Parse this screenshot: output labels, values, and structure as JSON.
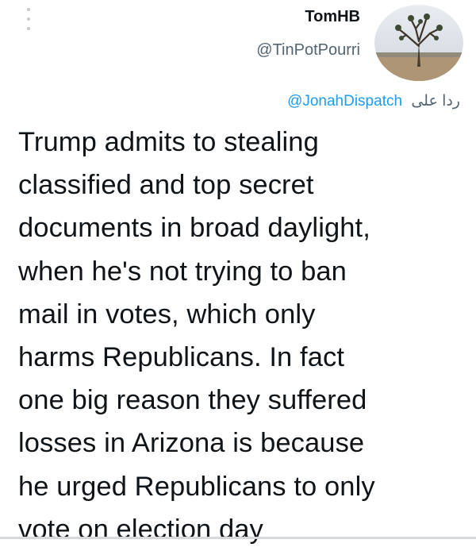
{
  "author": {
    "name": "TomHB",
    "handle": "@TinPotPourri",
    "avatar_icon": "joshua-tree-avatar"
  },
  "reply": {
    "label": "ردا على",
    "target": "@JonahDispatch"
  },
  "tweet": {
    "text": "Trump admits to stealing\nclassified and top secret\ndocuments in broad daylight,\nwhen he's not trying to ban\nmail in votes, which only\nharms Republicans. In fact\none big reason they suffered\nlosses in Arizona is because\nhe urged Republicans to only\nvote on election day"
  },
  "colors": {
    "text": "#0f1419",
    "secondary": "#536471",
    "accent": "#1d9bf0"
  }
}
